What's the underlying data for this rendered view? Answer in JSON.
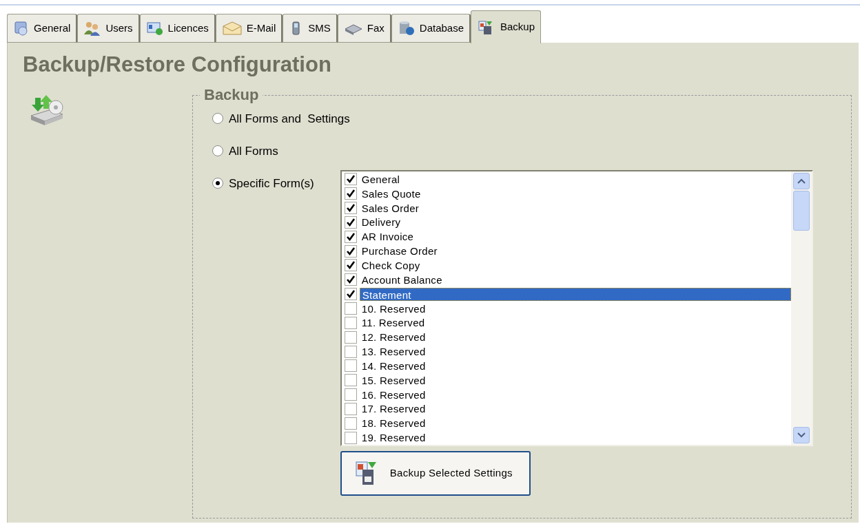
{
  "tabs": [
    {
      "label": "General",
      "selected": false
    },
    {
      "label": "Users",
      "selected": false
    },
    {
      "label": "Licences",
      "selected": false
    },
    {
      "label": "E-Mail",
      "selected": false
    },
    {
      "label": "SMS",
      "selected": false
    },
    {
      "label": "Fax",
      "selected": false
    },
    {
      "label": "Database",
      "selected": false
    },
    {
      "label": "Backup",
      "selected": true
    }
  ],
  "title": "Backup/Restore Configuration",
  "backup": {
    "legend": "Backup",
    "options": [
      {
        "label": "All Forms and  Settings",
        "selected": false
      },
      {
        "label": "All Forms",
        "selected": false
      },
      {
        "label": "Specific Form(s)",
        "selected": true
      }
    ],
    "forms": [
      {
        "label": "General",
        "checked": true,
        "selected": false
      },
      {
        "label": "Sales Quote",
        "checked": true,
        "selected": false
      },
      {
        "label": "Sales Order",
        "checked": true,
        "selected": false
      },
      {
        "label": "Delivery",
        "checked": true,
        "selected": false
      },
      {
        "label": "AR Invoice",
        "checked": true,
        "selected": false
      },
      {
        "label": "Purchase Order",
        "checked": true,
        "selected": false
      },
      {
        "label": "Check Copy",
        "checked": true,
        "selected": false
      },
      {
        "label": "Account Balance",
        "checked": true,
        "selected": false
      },
      {
        "label": "Statement",
        "checked": true,
        "selected": true
      },
      {
        "label": "10. Reserved",
        "checked": false,
        "selected": false
      },
      {
        "label": "11. Reserved",
        "checked": false,
        "selected": false
      },
      {
        "label": "12. Reserved",
        "checked": false,
        "selected": false
      },
      {
        "label": "13. Reserved",
        "checked": false,
        "selected": false
      },
      {
        "label": "14. Reserved",
        "checked": false,
        "selected": false
      },
      {
        "label": "15. Reserved",
        "checked": false,
        "selected": false
      },
      {
        "label": "16. Reserved",
        "checked": false,
        "selected": false
      },
      {
        "label": "17. Reserved",
        "checked": false,
        "selected": false
      },
      {
        "label": "18. Reserved",
        "checked": false,
        "selected": false
      },
      {
        "label": "19. Reserved",
        "checked": false,
        "selected": false
      }
    ],
    "button": "Backup Selected Settings"
  }
}
